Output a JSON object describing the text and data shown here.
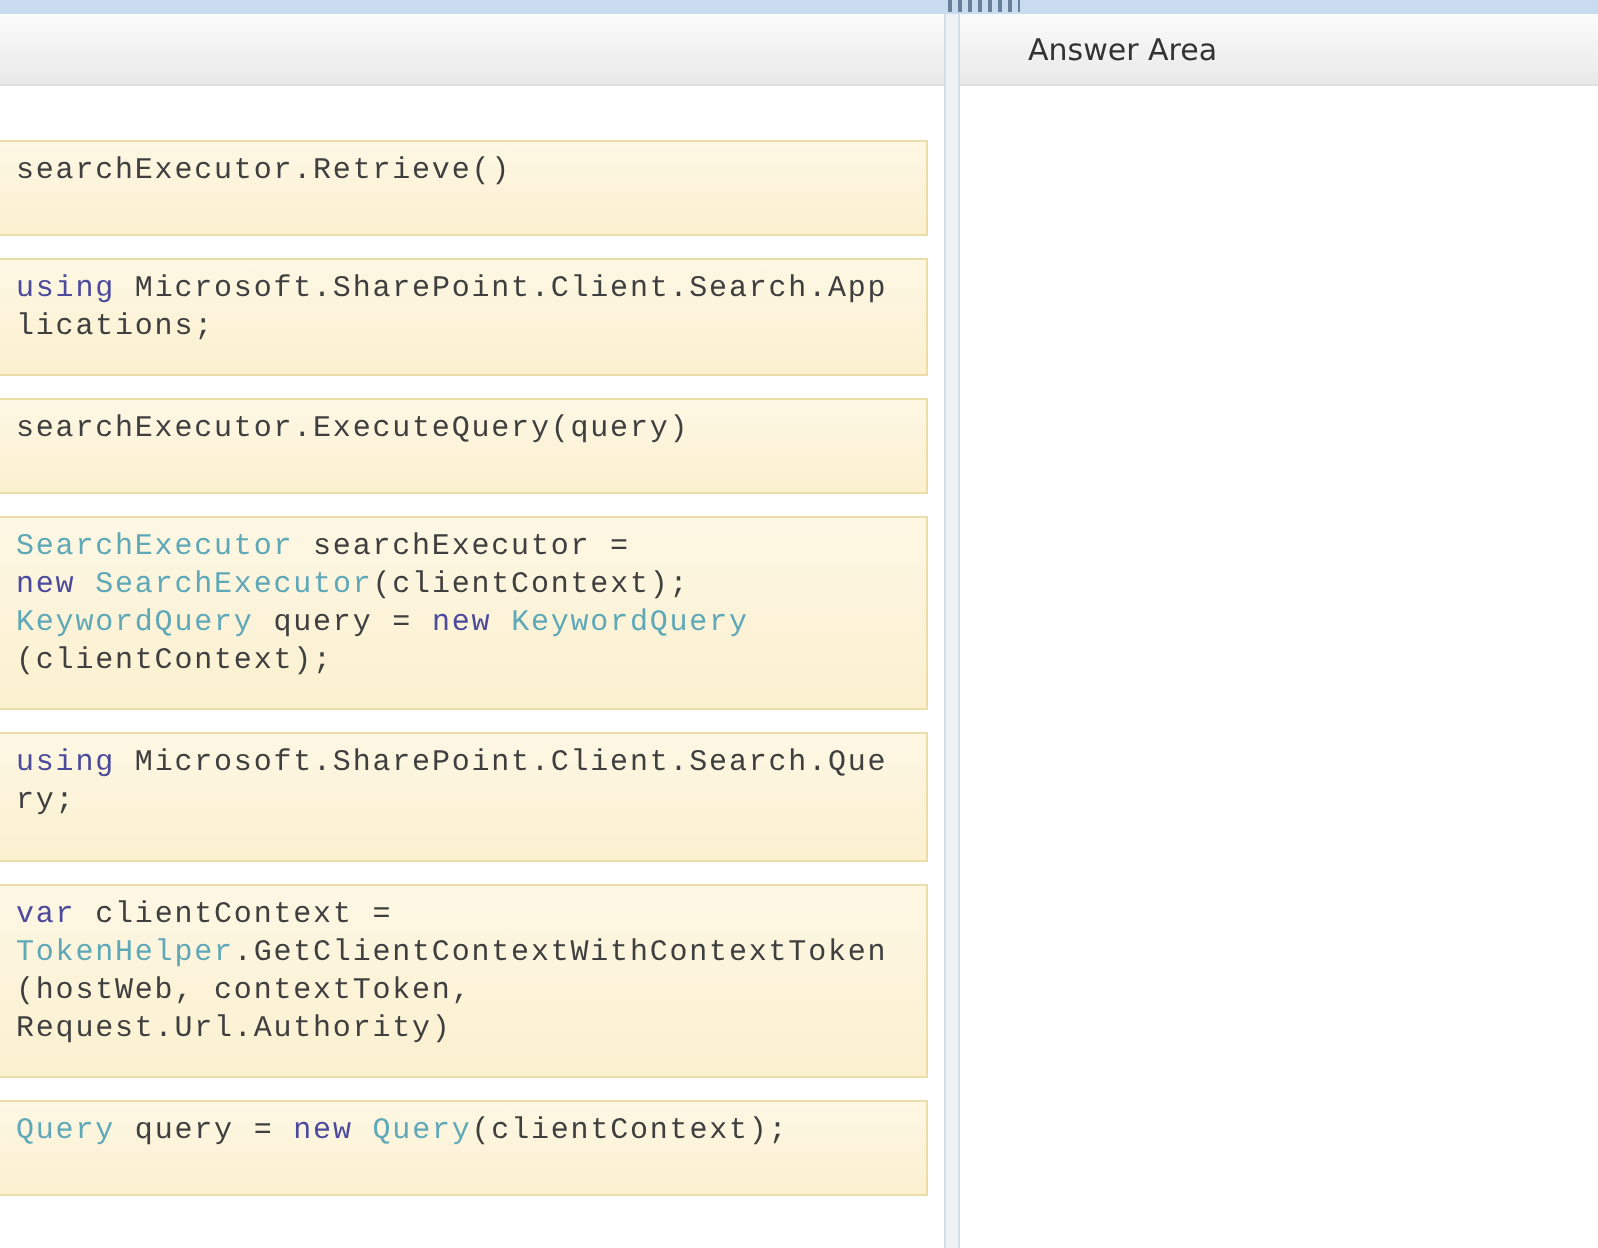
{
  "answer_area": {
    "title": "Answer Area"
  },
  "snippets": [
    {
      "lines": [
        [
          {
            "kind": "plain",
            "text": "searchExecutor.Retrieve()"
          }
        ]
      ]
    },
    {
      "lines": [
        [
          {
            "kind": "keyword",
            "text": "using"
          },
          {
            "kind": "plain",
            "text": " Microsoft.SharePoint.Client.Search.App"
          }
        ],
        [
          {
            "kind": "plain",
            "text": "lications;"
          }
        ]
      ]
    },
    {
      "lines": [
        [
          {
            "kind": "plain",
            "text": "searchExecutor.ExecuteQuery(query)"
          }
        ]
      ]
    },
    {
      "lines": [
        [
          {
            "kind": "type",
            "text": "SearchExecutor"
          },
          {
            "kind": "plain",
            "text": " searchExecutor ="
          }
        ],
        [
          {
            "kind": "keyword",
            "text": "new"
          },
          {
            "kind": "type",
            "text": " SearchExecutor"
          },
          {
            "kind": "plain",
            "text": "(clientContext);"
          }
        ],
        [
          {
            "kind": "type",
            "text": "KeywordQuery"
          },
          {
            "kind": "plain",
            "text": " query = "
          },
          {
            "kind": "keyword",
            "text": "new"
          },
          {
            "kind": "type",
            "text": " KeywordQuery"
          }
        ],
        [
          {
            "kind": "plain",
            "text": "(clientContext);"
          }
        ]
      ]
    },
    {
      "lines": [
        [
          {
            "kind": "keyword",
            "text": "using"
          },
          {
            "kind": "plain",
            "text": " Microsoft.SharePoint.Client.Search.Que"
          }
        ],
        [
          {
            "kind": "plain",
            "text": "ry;"
          }
        ]
      ]
    },
    {
      "lines": [
        [
          {
            "kind": "keyword",
            "text": "var"
          },
          {
            "kind": "plain",
            "text": " clientContext ="
          }
        ],
        [
          {
            "kind": "type",
            "text": "TokenHelper"
          },
          {
            "kind": "plain",
            "text": ".GetClientContextWithContextToken"
          }
        ],
        [
          {
            "kind": "plain",
            "text": "(hostWeb, contextToken,"
          }
        ],
        [
          {
            "kind": "plain",
            "text": "Request.Url.Authority)"
          }
        ]
      ]
    },
    {
      "lines": [
        [
          {
            "kind": "type",
            "text": "Query"
          },
          {
            "kind": "plain",
            "text": " query = "
          },
          {
            "kind": "keyword",
            "text": "new"
          },
          {
            "kind": "type",
            "text": " Query"
          },
          {
            "kind": "plain",
            "text": "(clientContext);"
          }
        ]
      ]
    }
  ]
}
